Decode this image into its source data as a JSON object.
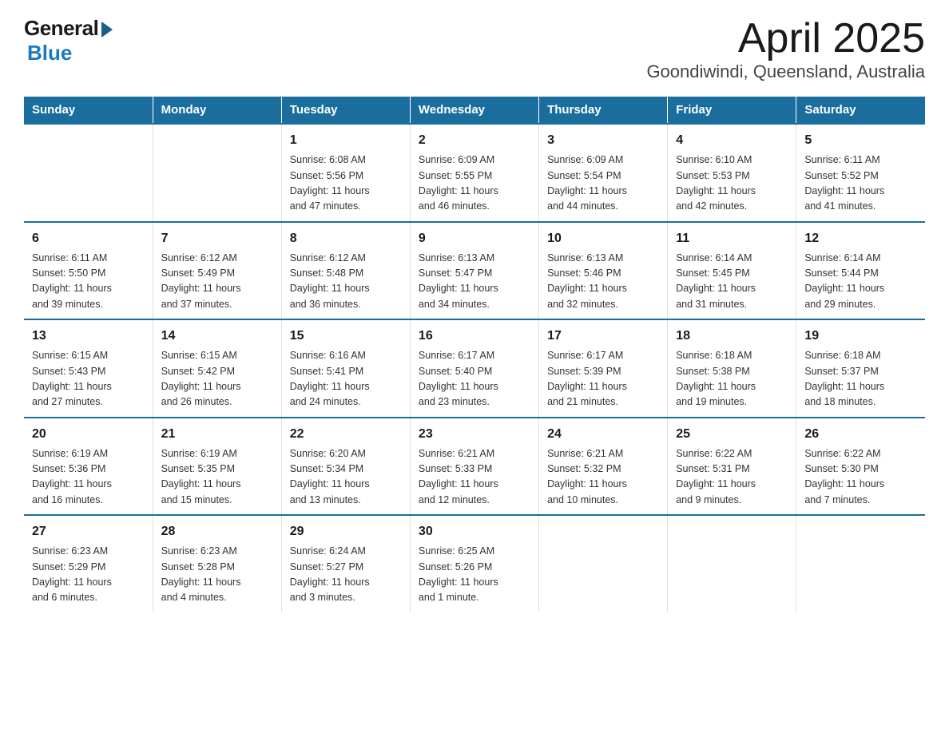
{
  "logo": {
    "general": "General",
    "blue": "Blue"
  },
  "title": "April 2025",
  "subtitle": "Goondiwindi, Queensland, Australia",
  "days_of_week": [
    "Sunday",
    "Monday",
    "Tuesday",
    "Wednesday",
    "Thursday",
    "Friday",
    "Saturday"
  ],
  "weeks": [
    [
      {
        "day": "",
        "info": ""
      },
      {
        "day": "",
        "info": ""
      },
      {
        "day": "1",
        "info": "Sunrise: 6:08 AM\nSunset: 5:56 PM\nDaylight: 11 hours\nand 47 minutes."
      },
      {
        "day": "2",
        "info": "Sunrise: 6:09 AM\nSunset: 5:55 PM\nDaylight: 11 hours\nand 46 minutes."
      },
      {
        "day": "3",
        "info": "Sunrise: 6:09 AM\nSunset: 5:54 PM\nDaylight: 11 hours\nand 44 minutes."
      },
      {
        "day": "4",
        "info": "Sunrise: 6:10 AM\nSunset: 5:53 PM\nDaylight: 11 hours\nand 42 minutes."
      },
      {
        "day": "5",
        "info": "Sunrise: 6:11 AM\nSunset: 5:52 PM\nDaylight: 11 hours\nand 41 minutes."
      }
    ],
    [
      {
        "day": "6",
        "info": "Sunrise: 6:11 AM\nSunset: 5:50 PM\nDaylight: 11 hours\nand 39 minutes."
      },
      {
        "day": "7",
        "info": "Sunrise: 6:12 AM\nSunset: 5:49 PM\nDaylight: 11 hours\nand 37 minutes."
      },
      {
        "day": "8",
        "info": "Sunrise: 6:12 AM\nSunset: 5:48 PM\nDaylight: 11 hours\nand 36 minutes."
      },
      {
        "day": "9",
        "info": "Sunrise: 6:13 AM\nSunset: 5:47 PM\nDaylight: 11 hours\nand 34 minutes."
      },
      {
        "day": "10",
        "info": "Sunrise: 6:13 AM\nSunset: 5:46 PM\nDaylight: 11 hours\nand 32 minutes."
      },
      {
        "day": "11",
        "info": "Sunrise: 6:14 AM\nSunset: 5:45 PM\nDaylight: 11 hours\nand 31 minutes."
      },
      {
        "day": "12",
        "info": "Sunrise: 6:14 AM\nSunset: 5:44 PM\nDaylight: 11 hours\nand 29 minutes."
      }
    ],
    [
      {
        "day": "13",
        "info": "Sunrise: 6:15 AM\nSunset: 5:43 PM\nDaylight: 11 hours\nand 27 minutes."
      },
      {
        "day": "14",
        "info": "Sunrise: 6:15 AM\nSunset: 5:42 PM\nDaylight: 11 hours\nand 26 minutes."
      },
      {
        "day": "15",
        "info": "Sunrise: 6:16 AM\nSunset: 5:41 PM\nDaylight: 11 hours\nand 24 minutes."
      },
      {
        "day": "16",
        "info": "Sunrise: 6:17 AM\nSunset: 5:40 PM\nDaylight: 11 hours\nand 23 minutes."
      },
      {
        "day": "17",
        "info": "Sunrise: 6:17 AM\nSunset: 5:39 PM\nDaylight: 11 hours\nand 21 minutes."
      },
      {
        "day": "18",
        "info": "Sunrise: 6:18 AM\nSunset: 5:38 PM\nDaylight: 11 hours\nand 19 minutes."
      },
      {
        "day": "19",
        "info": "Sunrise: 6:18 AM\nSunset: 5:37 PM\nDaylight: 11 hours\nand 18 minutes."
      }
    ],
    [
      {
        "day": "20",
        "info": "Sunrise: 6:19 AM\nSunset: 5:36 PM\nDaylight: 11 hours\nand 16 minutes."
      },
      {
        "day": "21",
        "info": "Sunrise: 6:19 AM\nSunset: 5:35 PM\nDaylight: 11 hours\nand 15 minutes."
      },
      {
        "day": "22",
        "info": "Sunrise: 6:20 AM\nSunset: 5:34 PM\nDaylight: 11 hours\nand 13 minutes."
      },
      {
        "day": "23",
        "info": "Sunrise: 6:21 AM\nSunset: 5:33 PM\nDaylight: 11 hours\nand 12 minutes."
      },
      {
        "day": "24",
        "info": "Sunrise: 6:21 AM\nSunset: 5:32 PM\nDaylight: 11 hours\nand 10 minutes."
      },
      {
        "day": "25",
        "info": "Sunrise: 6:22 AM\nSunset: 5:31 PM\nDaylight: 11 hours\nand 9 minutes."
      },
      {
        "day": "26",
        "info": "Sunrise: 6:22 AM\nSunset: 5:30 PM\nDaylight: 11 hours\nand 7 minutes."
      }
    ],
    [
      {
        "day": "27",
        "info": "Sunrise: 6:23 AM\nSunset: 5:29 PM\nDaylight: 11 hours\nand 6 minutes."
      },
      {
        "day": "28",
        "info": "Sunrise: 6:23 AM\nSunset: 5:28 PM\nDaylight: 11 hours\nand 4 minutes."
      },
      {
        "day": "29",
        "info": "Sunrise: 6:24 AM\nSunset: 5:27 PM\nDaylight: 11 hours\nand 3 minutes."
      },
      {
        "day": "30",
        "info": "Sunrise: 6:25 AM\nSunset: 5:26 PM\nDaylight: 11 hours\nand 1 minute."
      },
      {
        "day": "",
        "info": ""
      },
      {
        "day": "",
        "info": ""
      },
      {
        "day": "",
        "info": ""
      }
    ]
  ]
}
